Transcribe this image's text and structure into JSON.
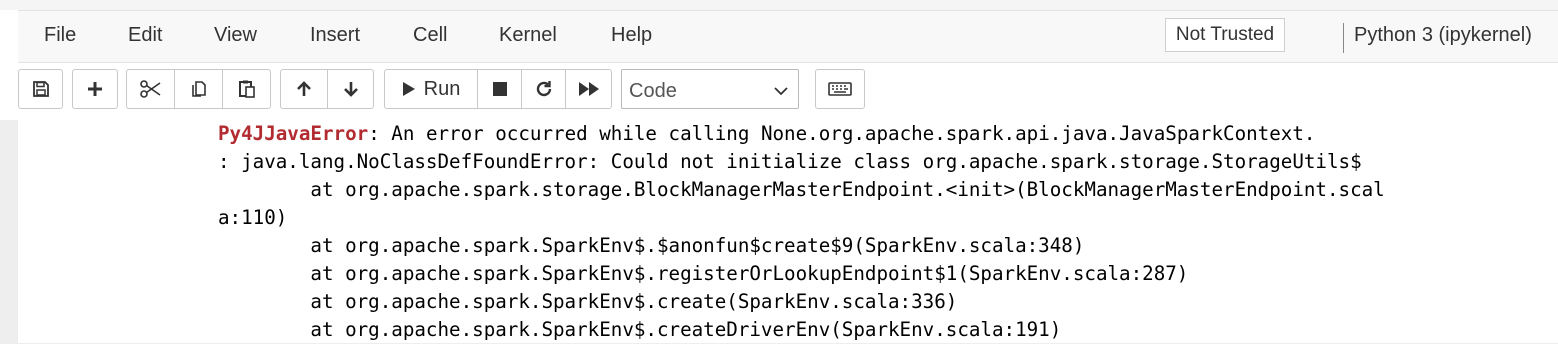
{
  "menubar": {
    "items": [
      "File",
      "Edit",
      "View",
      "Insert",
      "Cell",
      "Kernel",
      "Help"
    ],
    "trust_status": "Not Trusted",
    "kernel_name": "Python 3 (ipykernel)"
  },
  "toolbar": {
    "buttons": [
      {
        "icon": "save-icon"
      },
      {
        "icon": "plus-icon"
      },
      {
        "icon": "scissors-icon"
      },
      {
        "icon": "copy-icon"
      },
      {
        "icon": "paste-icon"
      },
      {
        "icon": "arrow-up-icon"
      },
      {
        "icon": "arrow-down-icon"
      },
      {
        "icon": "play-icon"
      },
      {
        "icon": "stop-icon"
      },
      {
        "icon": "restart-icon"
      },
      {
        "icon": "fast-forward-icon"
      },
      {
        "icon": "keyboard-icon"
      }
    ],
    "run_label": "Run",
    "cell_type": "Code"
  },
  "output": {
    "error_name": "Py4JJavaError",
    "error_message": ": An error occurred while calling None.org.apache.spark.api.java.JavaSparkContext.",
    "lines": [
      ": java.lang.NoClassDefFoundError: Could not initialize class org.apache.spark.storage.StorageUtils$",
      "        at org.apache.spark.storage.BlockManagerMasterEndpoint.<init>(BlockManagerMasterEndpoint.scal",
      "a:110)",
      "        at org.apache.spark.SparkEnv$.$anonfun$create$9(SparkEnv.scala:348)",
      "        at org.apache.spark.SparkEnv$.registerOrLookupEndpoint$1(SparkEnv.scala:287)",
      "        at org.apache.spark.SparkEnv$.create(SparkEnv.scala:336)",
      "        at org.apache.spark.SparkEnv$.createDriverEnv(SparkEnv.scala:191)"
    ]
  },
  "colors": {
    "error_name": "#b22b31",
    "menubar_bg": "#f8f8f8",
    "page_bg": "#eeeeee"
  }
}
